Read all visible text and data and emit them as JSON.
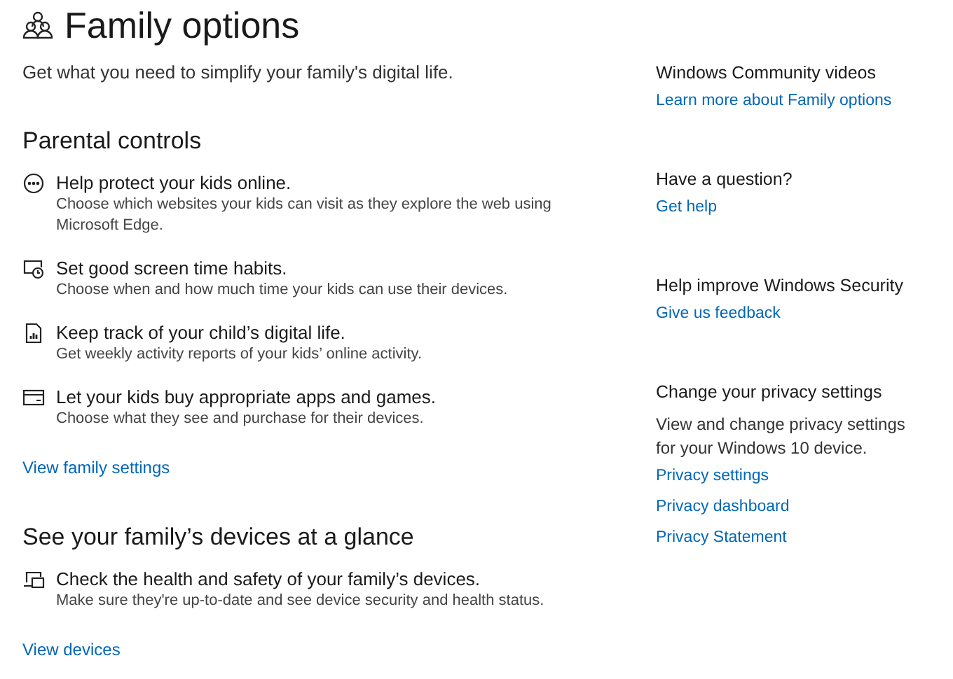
{
  "header": {
    "title": "Family options",
    "subtitle": "Get what you need to simplify your family's digital life."
  },
  "sections": [
    {
      "heading": "Parental controls",
      "items": [
        {
          "kind": "browsing",
          "title": "Help protect your kids online.",
          "description": "Choose which websites your kids can visit as they explore the web using Microsoft Edge."
        },
        {
          "kind": "screen-time",
          "title": "Set good screen time habits.",
          "description": "Choose when and how much time your kids can use their devices."
        },
        {
          "kind": "report",
          "title": "Keep track of your child’s digital life.",
          "description": "Get weekly activity reports of your kids’ online activity."
        },
        {
          "kind": "purchase",
          "title": "Let your kids buy appropriate apps and games.",
          "description": "Choose what they see and purchase for their devices."
        }
      ],
      "link": "View family settings"
    },
    {
      "heading": "See your family’s devices at a glance",
      "items": [
        {
          "kind": "devices",
          "title": "Check the health and safety of your family’s devices.",
          "description": "Make sure they're up-to-date and see device security and health status."
        }
      ],
      "link": "View devices"
    }
  ],
  "sidebar": [
    {
      "heading": "Windows Community videos",
      "links": [
        "Learn more about Family options"
      ]
    },
    {
      "heading": "Have a question?",
      "links": [
        "Get help"
      ]
    },
    {
      "heading": "Help improve Windows Security",
      "links": [
        "Give us feedback"
      ]
    },
    {
      "heading": "Change your privacy settings",
      "text": "View and change privacy settings for your Windows 10 device.",
      "links": [
        "Privacy settings",
        "Privacy dashboard",
        "Privacy Statement"
      ]
    }
  ]
}
